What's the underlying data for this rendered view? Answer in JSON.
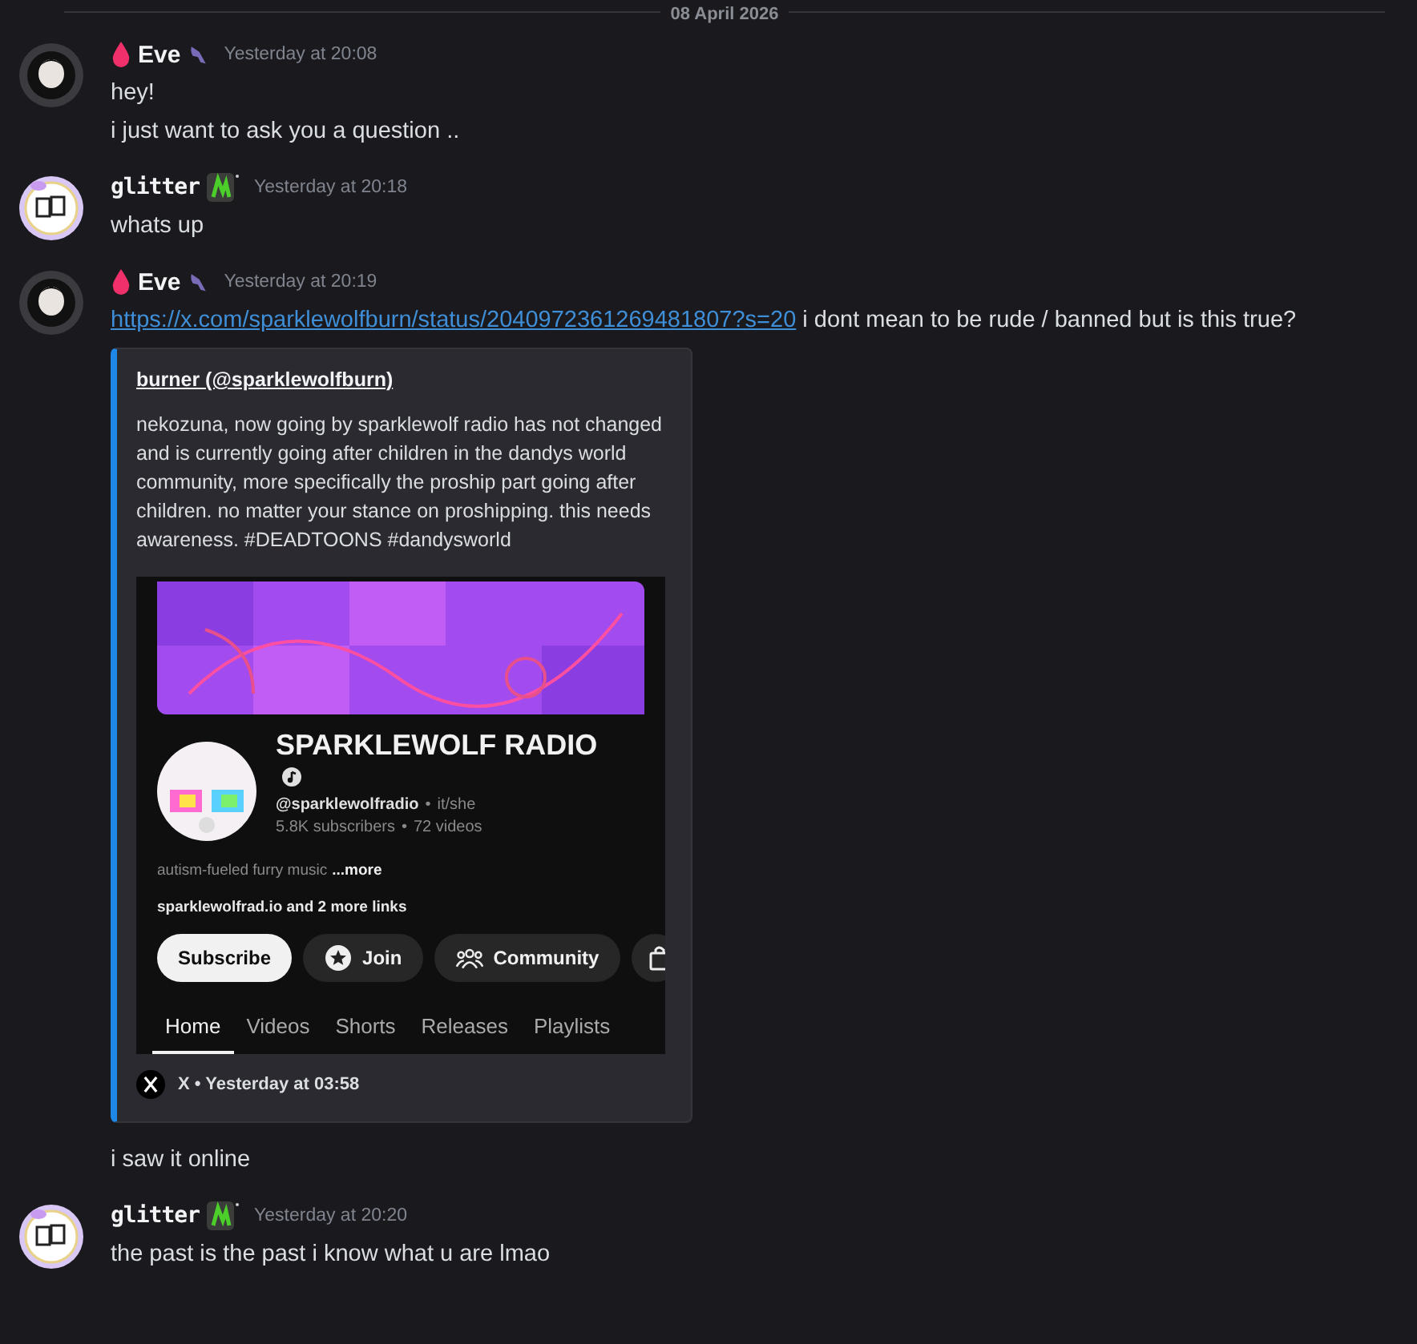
{
  "date_divider": "08 April 2026",
  "messages": [
    {
      "author": "Eve",
      "kind": "droplet",
      "time": "Yesterday at 20:08",
      "lines": [
        {
          "text": "hey!"
        },
        {
          "text": "i just want to ask you a question .."
        }
      ]
    },
    {
      "author": "glitter",
      "kind": "badge",
      "time": "Yesterday at 20:18",
      "lines": [
        {
          "text": "whats up"
        }
      ]
    },
    {
      "author": "Eve",
      "kind": "droplet",
      "time": "Yesterday at 20:19",
      "lines": [
        {
          "link": "https://x.com/sparklewolfburn/status/2040972361269481807?s=20",
          "text": "i dont mean to be rude / banned but is this true?"
        },
        {
          "kind": "embed"
        },
        {
          "text": "i saw it online"
        }
      ]
    },
    {
      "author": "glitter",
      "kind": "badge",
      "time": "Yesterday at 20:20",
      "lines": [
        {
          "text": "the past is the past i know what u are lmao"
        }
      ]
    }
  ],
  "embed": {
    "author": "burner (@sparklewolfburn)",
    "description": "nekozuna, now going by sparklewolf radio has not changed and is currently going after children in the dandys world community, more specifically the proship part going after children. no matter your stance on proshipping. this needs awareness. #DEADTOONS #dandysworld",
    "image": {
      "channel_name": "SPARKLEWOLF RADIO",
      "separator": "•",
      "handle": "@sparklewolfradio",
      "pronouns": "it/she",
      "stats": [
        "5.8K subscribers",
        "72 videos"
      ],
      "about": "autism-fueled furry music",
      "more": "...more",
      "links": "sparklewolfrad.io and 2 more links",
      "buttons": [
        {
          "kind": "subscribe",
          "label": "Subscribe"
        },
        {
          "kind": "join",
          "label": "Join"
        },
        {
          "kind": "community",
          "label": "Community"
        },
        {
          "kind": "partial"
        }
      ],
      "tabs": [
        {
          "label": "Home",
          "selected": true
        },
        {
          "label": "Videos",
          "selected": false
        },
        {
          "label": "Shorts",
          "selected": false
        },
        {
          "label": "Releases",
          "selected": false
        },
        {
          "label": "Playlists",
          "selected": false
        }
      ]
    },
    "footer": "X • Yesterday at 03:58"
  }
}
